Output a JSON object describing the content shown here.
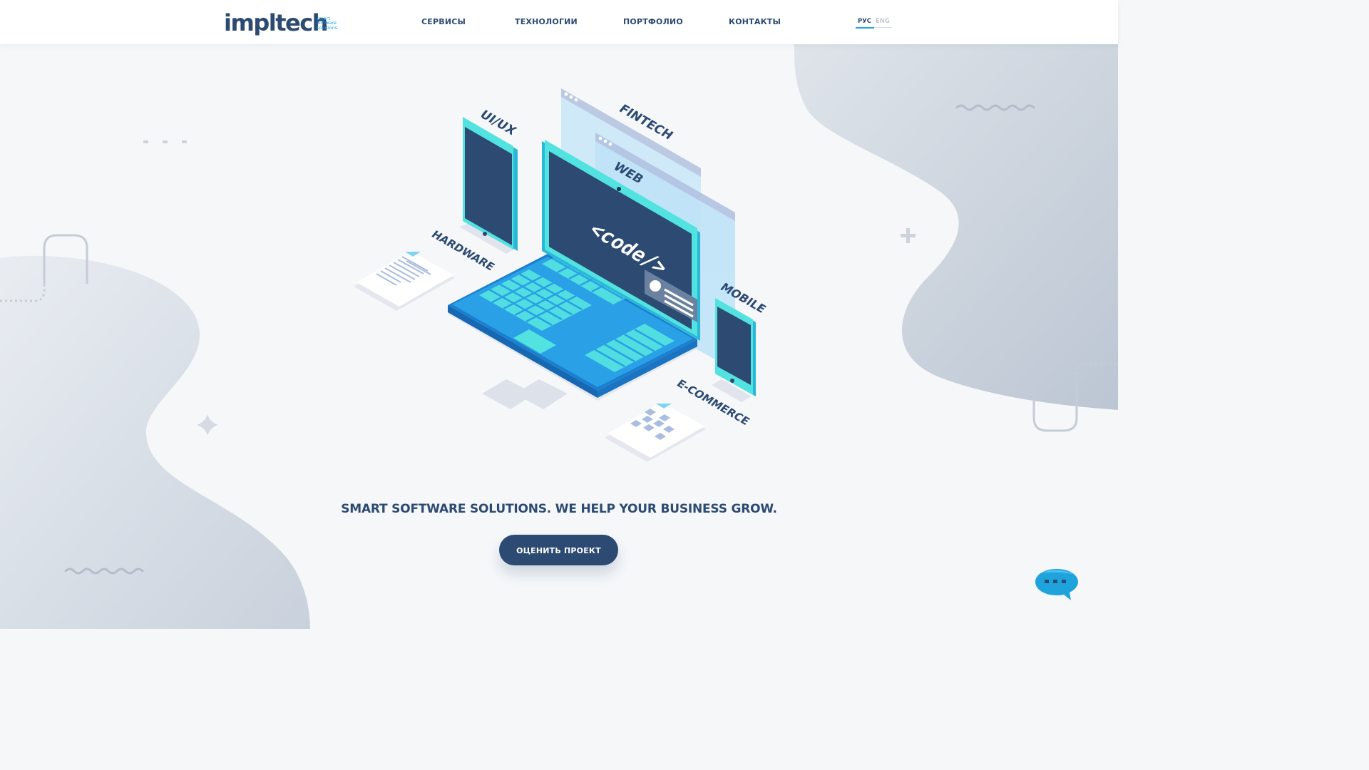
{
  "header": {
    "logo": {
      "wordmark": "impltech",
      "tagline_lines": [
        "smart",
        "software",
        "solutions"
      ]
    },
    "nav": [
      {
        "label": "СЕРВИСЫ"
      },
      {
        "label": "ТЕХНОЛОГИИ"
      },
      {
        "label": "ПОРТФОЛИО"
      },
      {
        "label": "КОНТАКТЫ"
      }
    ],
    "languages": {
      "active": "РУС",
      "inactive": "ENG"
    }
  },
  "hero": {
    "illustration_labels": {
      "uiux": "UI/UX",
      "fintech": "FINTECH",
      "web": "WEB",
      "hardware": "HARDWARE",
      "mobile": "MOBILE",
      "ecommerce": "E-COMMERCE",
      "screen_code": "<code/>"
    },
    "tagline": "SMART SOFTWARE SOLUTIONS. WE HELP YOUR BUSINESS GROW.",
    "cta_label": "ОЦЕНИТЬ ПРОЕКТ"
  },
  "chat_widget": {
    "icon": "chat-bubble-icon"
  },
  "colors": {
    "primary": "#2c4a72",
    "accent": "#1fa3dd",
    "teal": "#4fe3df",
    "background": "#f5f7f9"
  }
}
